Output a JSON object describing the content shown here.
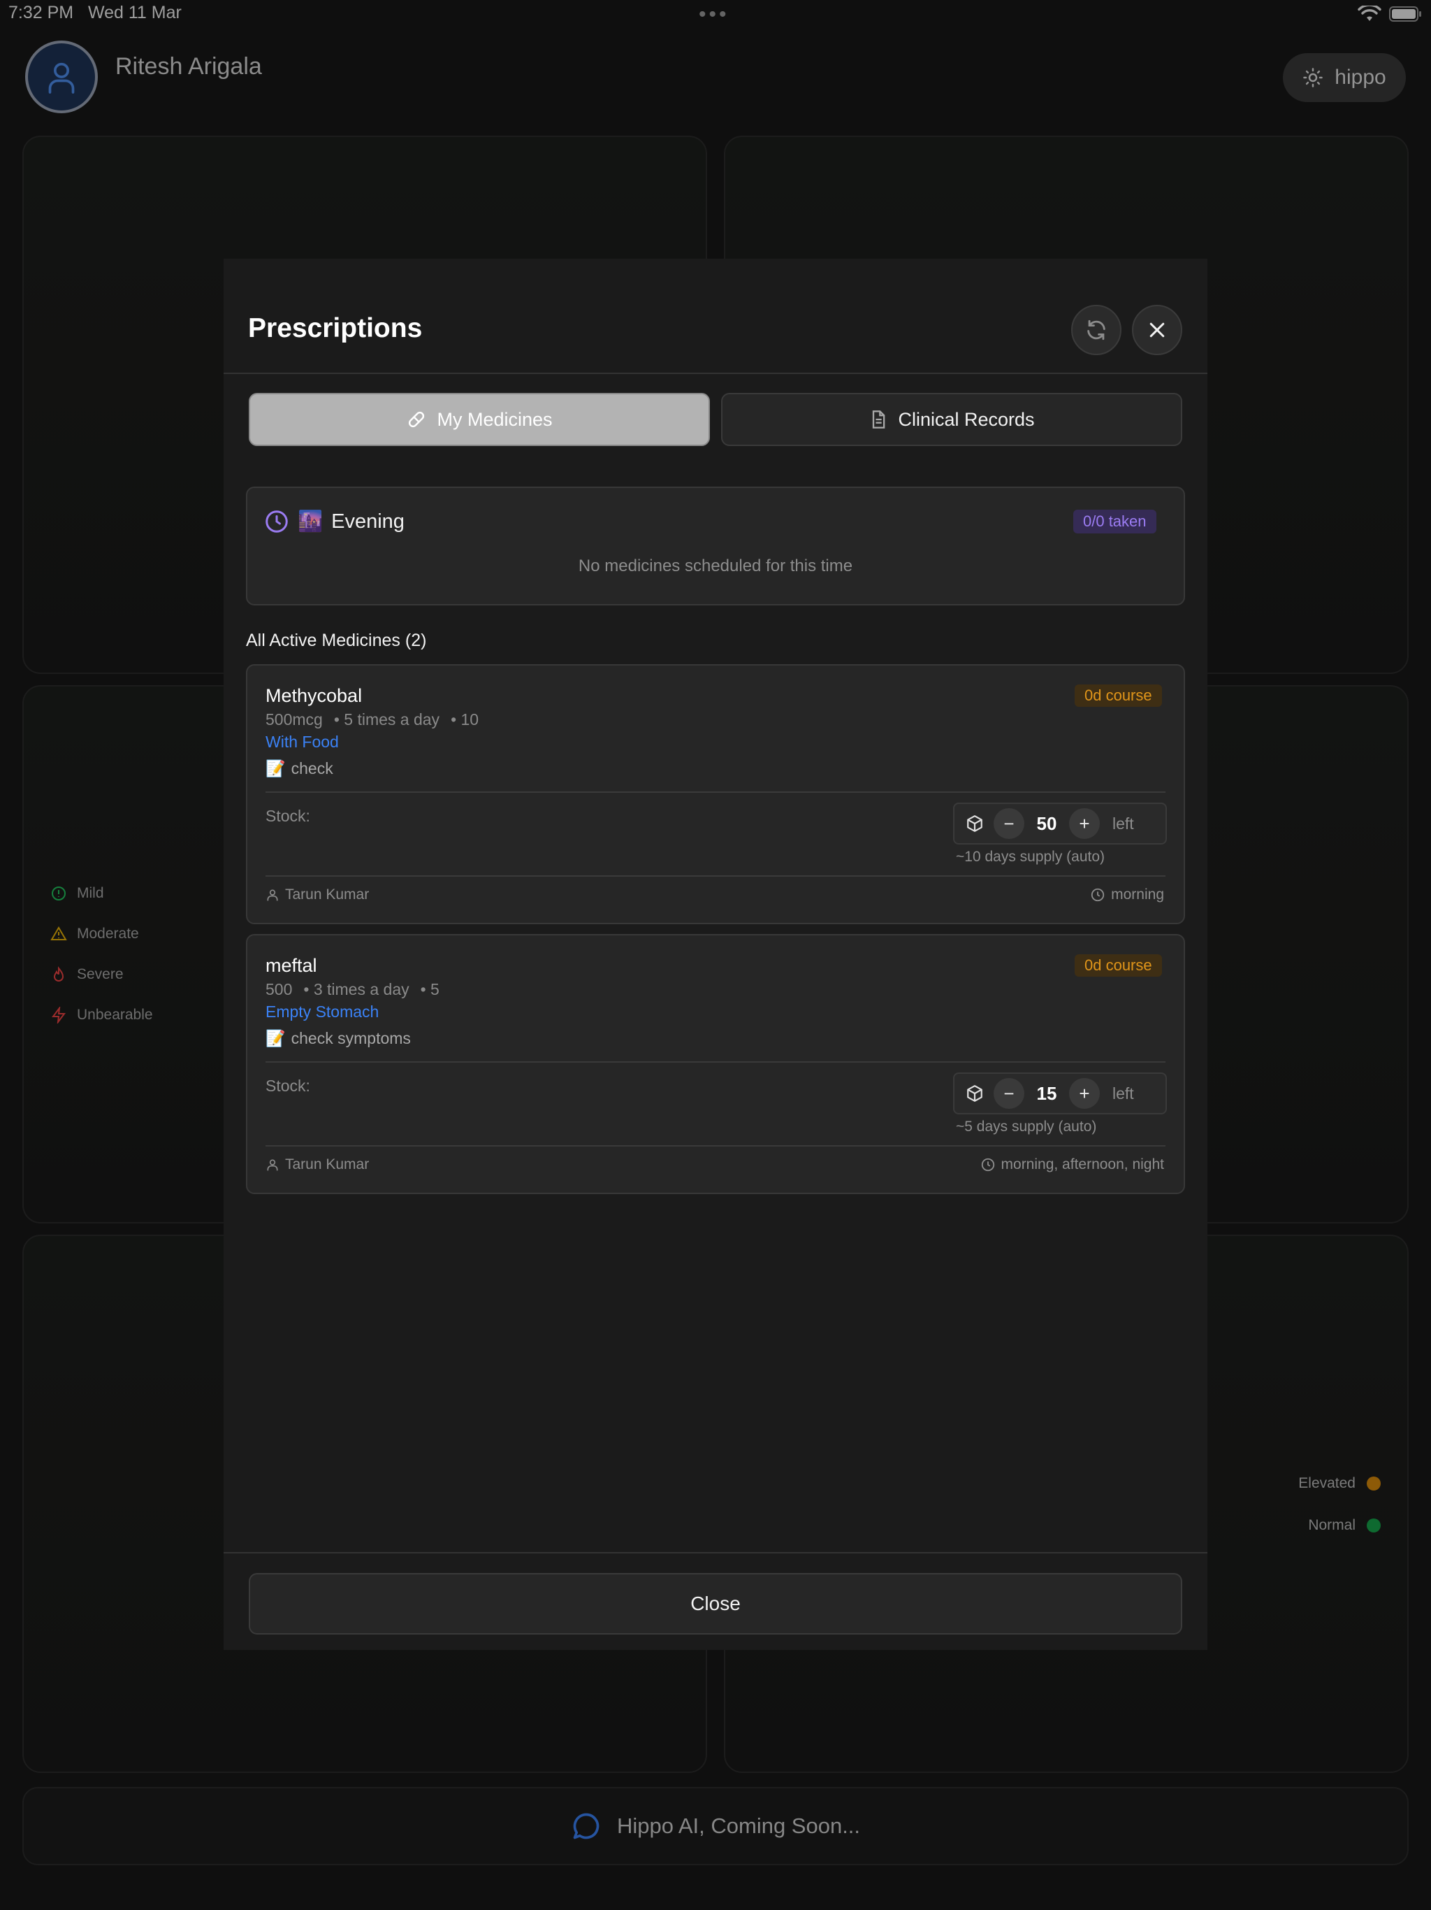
{
  "status_bar": {
    "time": "7:32 PM",
    "date": "Wed 11 Mar",
    "dots": "•••"
  },
  "header": {
    "user_name": "Ritesh Arigala",
    "theme_button_label": "hippo",
    "avatar_icon": "user-icon",
    "theme_icon": "sun-icon"
  },
  "background": {
    "severity_legend": [
      "Mild",
      "Moderate",
      "Severe",
      "Unbearable"
    ],
    "status_legend": [
      {
        "label": "Elevated",
        "color": "#d98a0c"
      },
      {
        "label": "Normal",
        "color": "#16a34a"
      }
    ],
    "ai_banner": "Hippo AI, Coming Soon..."
  },
  "modal": {
    "title": "Prescriptions",
    "tabs": [
      {
        "label": "My Medicines",
        "icon": "pill-icon",
        "active": true
      },
      {
        "label": "Clinical Records",
        "icon": "file-icon",
        "active": false
      }
    ],
    "schedule": {
      "emoji": "🌆",
      "label": "Evening",
      "taken_badge": "0/0 taken",
      "empty_message": "No medicines scheduled for this time"
    },
    "section_title": "All Active Medicines (2)",
    "medicines": [
      {
        "name": "Methycobal",
        "dose": "500mcg",
        "frequency": "• 5 times a day",
        "quantity": "• 10",
        "food_instruction": "With Food",
        "note_emoji": "📝",
        "note": "check",
        "course_badge": "0d course",
        "stock_label": "Stock:",
        "stock_value": "50",
        "stock_suffix": "left",
        "supply_text": "~10 days supply (auto)",
        "prescriber": "Tarun Kumar",
        "timing": "morning"
      },
      {
        "name": "meftal",
        "dose": "500",
        "frequency": "• 3 times a day",
        "quantity": "• 5",
        "food_instruction": "Empty Stomach",
        "note_emoji": "📝",
        "note": "check symptoms",
        "course_badge": "0d course",
        "stock_label": "Stock:",
        "stock_value": "15",
        "stock_suffix": "left",
        "supply_text": "~5 days supply (auto)",
        "prescriber": "Tarun Kumar",
        "timing": "morning, afternoon, night"
      }
    ],
    "close_label": "Close",
    "stepper": {
      "minus": "−",
      "plus": "+"
    }
  },
  "colors": {
    "accent_purple": "#9b7cf2",
    "accent_blue": "#3b82f6",
    "badge_orange": "#e0951a"
  }
}
